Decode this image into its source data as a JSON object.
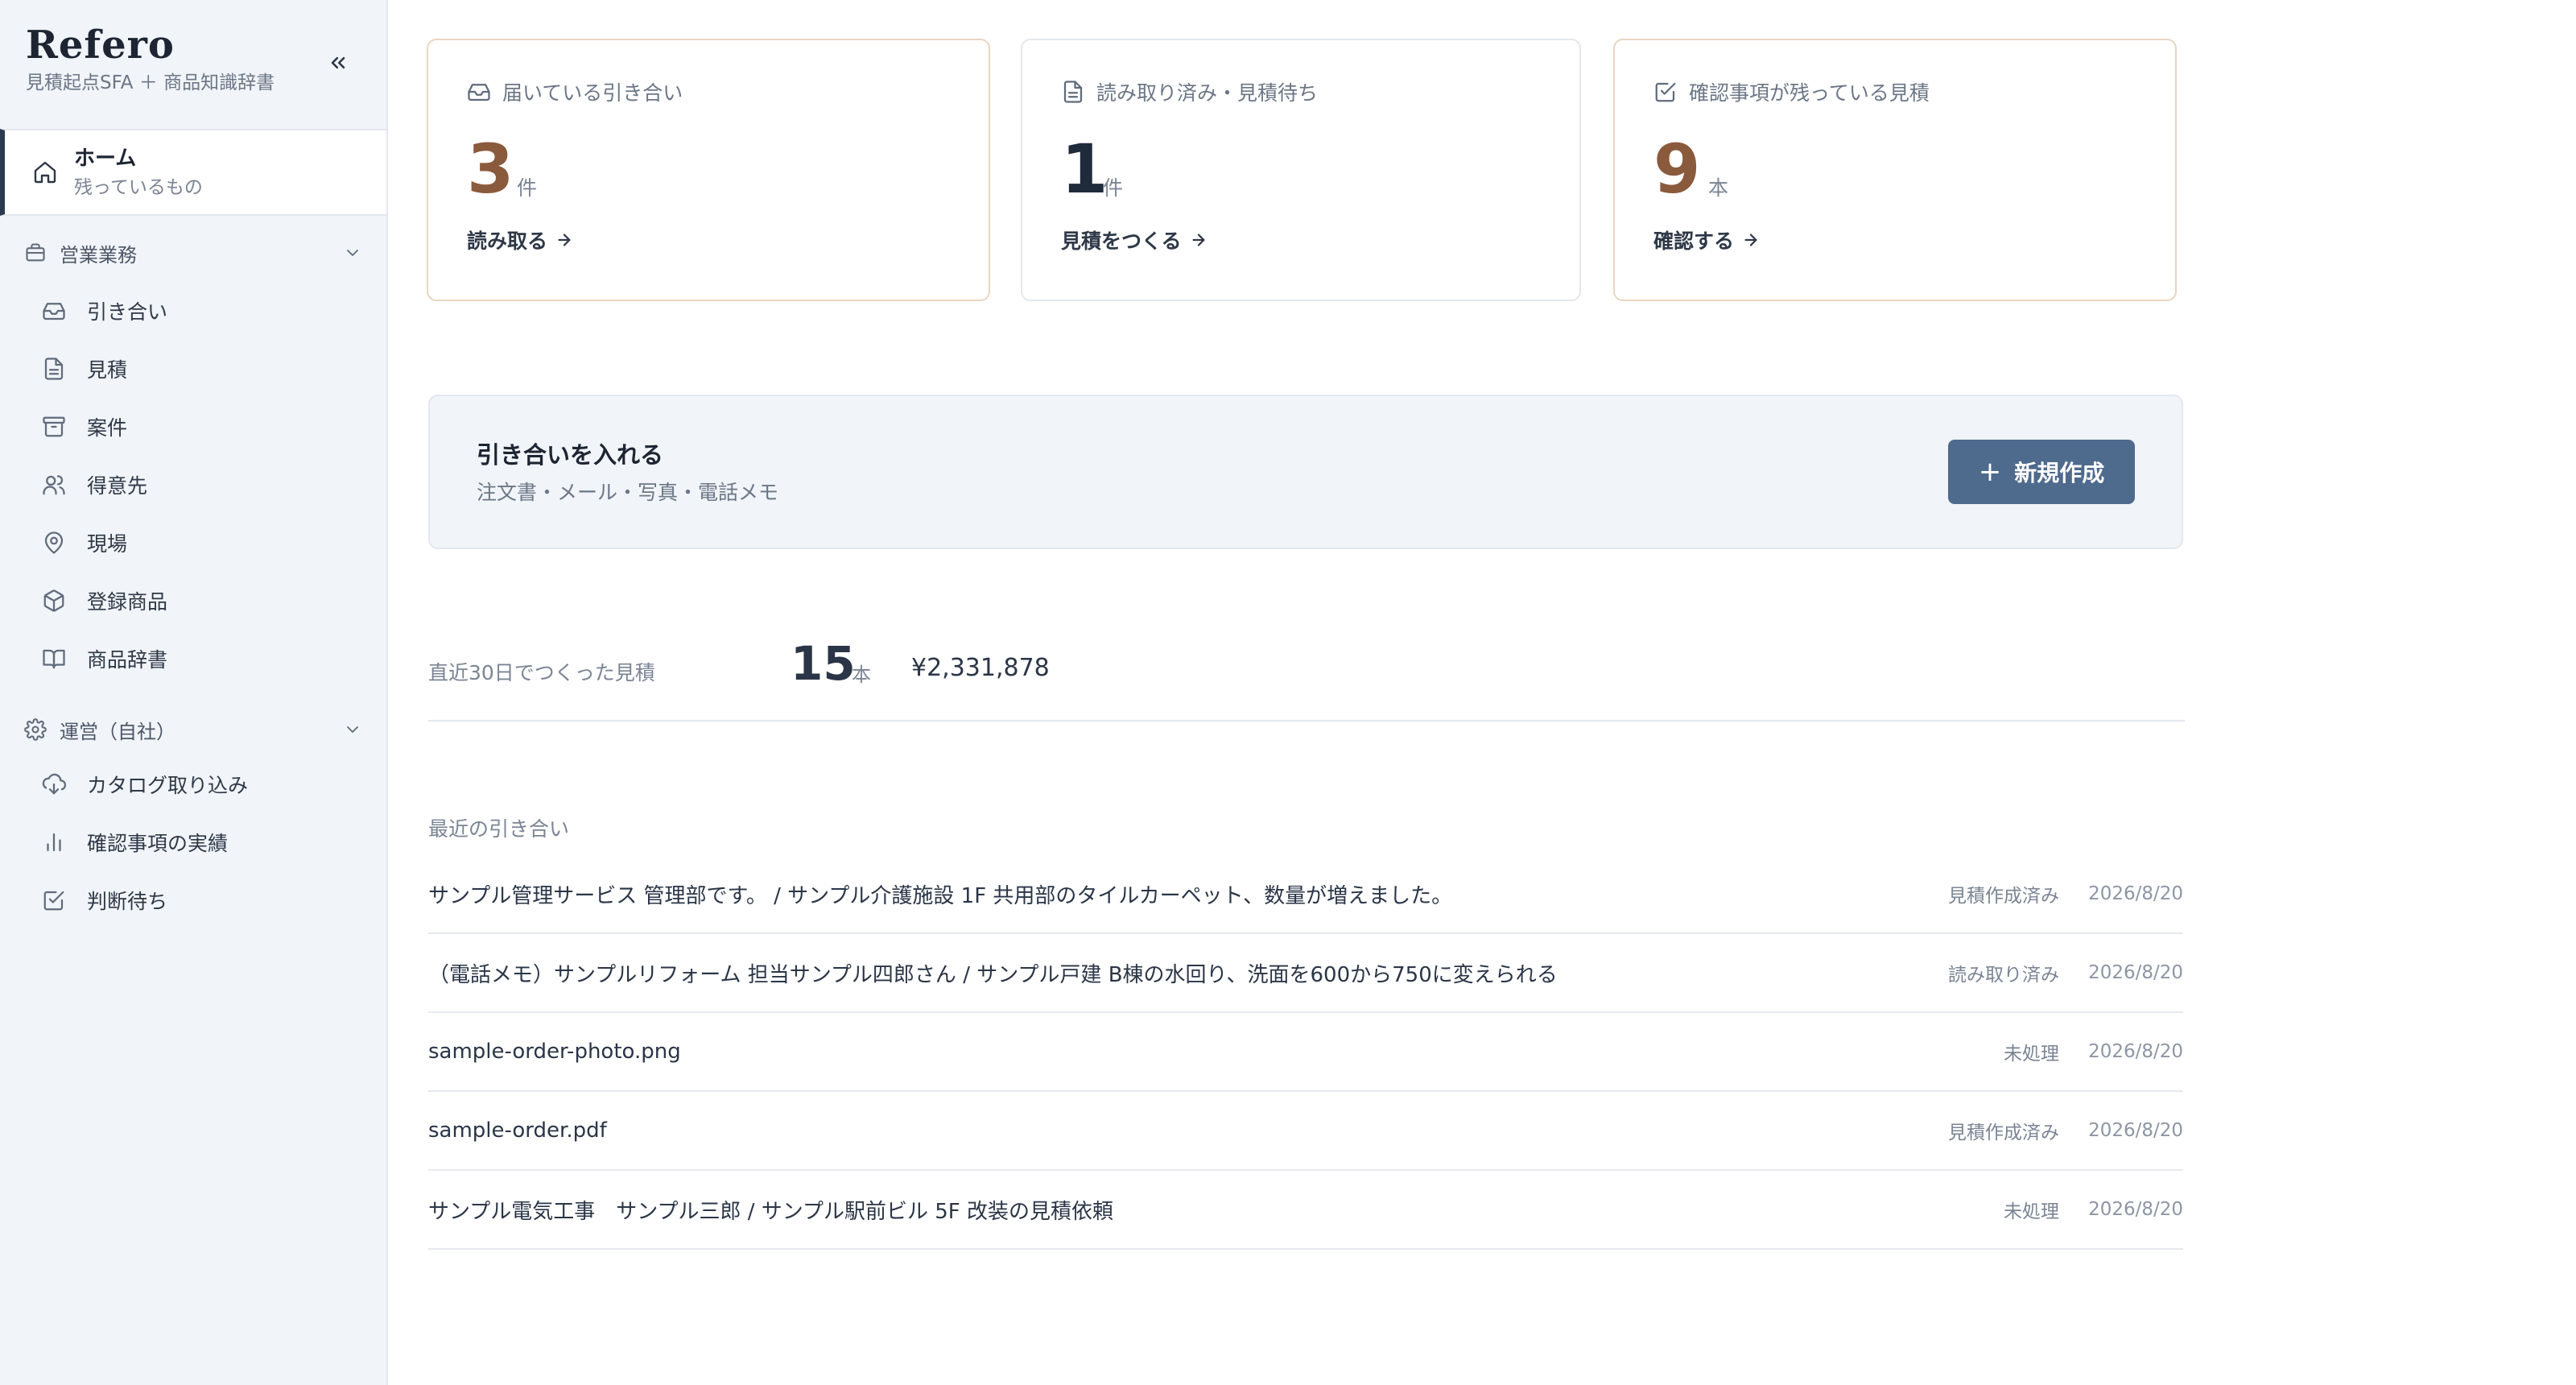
{
  "sidebar": {
    "brand": {
      "title": "Refero",
      "subtitle": "見積起点SFA ＋ 商品知識辞書"
    },
    "home": {
      "label": "ホーム",
      "sublabel": "残っているもの"
    },
    "sections": [
      {
        "label": "営業業務",
        "items": [
          {
            "label": "引き合い",
            "icon": "inbox-icon"
          },
          {
            "label": "見積",
            "icon": "document-icon"
          },
          {
            "label": "案件",
            "icon": "archive-icon"
          },
          {
            "label": "得意先",
            "icon": "users-icon"
          },
          {
            "label": "現場",
            "icon": "map-pin-icon"
          },
          {
            "label": "登録商品",
            "icon": "package-icon"
          },
          {
            "label": "商品辞書",
            "icon": "book-icon"
          }
        ]
      },
      {
        "label": "運営（自社）",
        "items": [
          {
            "label": "カタログ取り込み",
            "icon": "cloud-download-icon"
          },
          {
            "label": "確認事項の実績",
            "icon": "bar-chart-icon"
          },
          {
            "label": "判断待ち",
            "icon": "check-square-icon"
          }
        ]
      }
    ]
  },
  "cards": [
    {
      "label": "届いている引き合い",
      "value": "3",
      "unit": "件",
      "link": "読み取る",
      "icon": "inbox-icon"
    },
    {
      "label": "読み取り済み・見積待ち",
      "value": "1",
      "unit": "件",
      "link": "見積をつくる",
      "icon": "document-icon"
    },
    {
      "label": "確認事項が残っている見積",
      "value": "9",
      "unit": "本",
      "link": "確認する",
      "icon": "check-square-icon"
    }
  ],
  "intake": {
    "title": "引き合いを入れる",
    "subtitle": "注文書・メール・写真・電話メモ",
    "button": "新規作成"
  },
  "stats": {
    "label": "直近30日でつくった見積",
    "count": "15",
    "unit": "本",
    "amount": "¥2,331,878"
  },
  "recent": {
    "label": "最近の引き合い",
    "rows": [
      {
        "title": "サンプル管理サービス 管理部です。 / サンプル介護施設 1F 共用部のタイルカーペット、数量が増えました。",
        "status": "見積作成済み",
        "date": "2026/8/20"
      },
      {
        "title": "（電話メモ）サンプルリフォーム 担当サンプル四郎さん / サンプル戸建 B棟の水回り、洗面を600から750に変えられる",
        "status": "読み取り済み",
        "date": "2026/8/20"
      },
      {
        "title": "sample-order-photo.png",
        "status": "未処理",
        "date": "2026/8/20"
      },
      {
        "title": "sample-order.pdf",
        "status": "見積作成済み",
        "date": "2026/8/20"
      },
      {
        "title": "サンプル電気工事　サンプル三郎 / サンプル駅前ビル 5F 改装の見積依頼",
        "status": "未処理",
        "date": "2026/8/20"
      }
    ]
  },
  "colors": {
    "accent_brown": "#8a5a3c",
    "primary_button": "#4e6a8d",
    "sidebar_bg": "#f1f4f8"
  }
}
